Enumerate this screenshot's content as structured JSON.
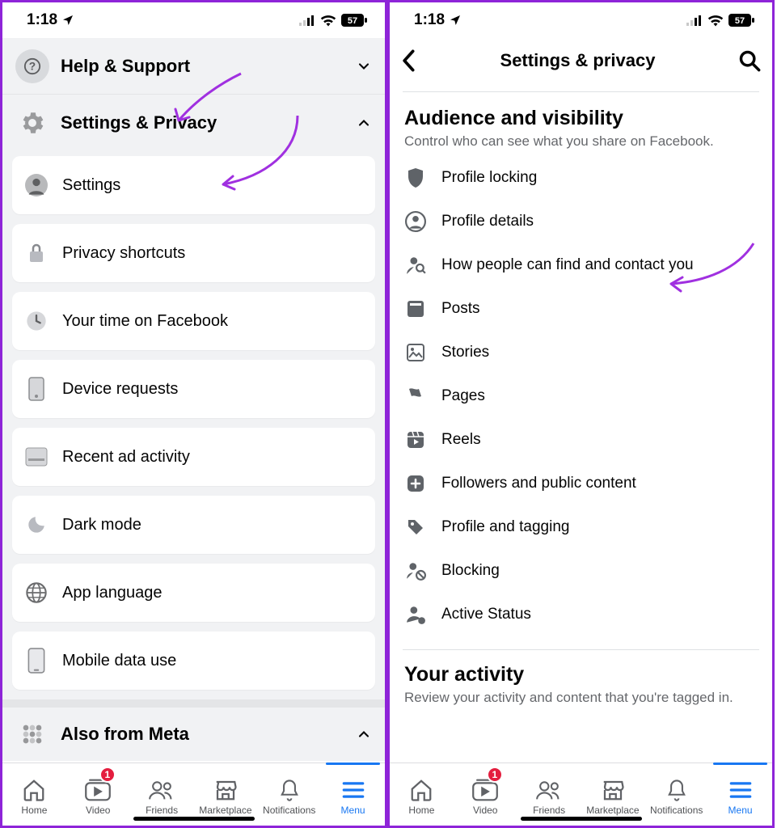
{
  "status": {
    "time": "1:18",
    "battery": "57"
  },
  "left": {
    "help_support": "Help & Support",
    "settings_privacy": "Settings & Privacy",
    "items": [
      {
        "label": "Settings"
      },
      {
        "label": "Privacy shortcuts"
      },
      {
        "label": "Your time on Facebook"
      },
      {
        "label": "Device requests"
      },
      {
        "label": "Recent ad activity"
      },
      {
        "label": "Dark mode"
      },
      {
        "label": "App language"
      },
      {
        "label": "Mobile data use"
      }
    ],
    "also_from_meta": "Also from Meta"
  },
  "right": {
    "title": "Settings & privacy",
    "section1_title": "Audience and visibility",
    "section1_sub": "Control who can see what you share on Facebook.",
    "items": [
      {
        "label": "Profile locking"
      },
      {
        "label": "Profile details"
      },
      {
        "label": "How people can find and contact you"
      },
      {
        "label": "Posts"
      },
      {
        "label": "Stories"
      },
      {
        "label": "Pages"
      },
      {
        "label": "Reels"
      },
      {
        "label": "Followers and public content"
      },
      {
        "label": "Profile and tagging"
      },
      {
        "label": "Blocking"
      },
      {
        "label": "Active Status"
      }
    ],
    "section2_title": "Your activity",
    "section2_sub": "Review your activity and content that you're tagged in."
  },
  "tabs": [
    {
      "label": "Home"
    },
    {
      "label": "Video",
      "badge": "1"
    },
    {
      "label": "Friends"
    },
    {
      "label": "Marketplace"
    },
    {
      "label": "Notifications"
    },
    {
      "label": "Menu"
    }
  ]
}
